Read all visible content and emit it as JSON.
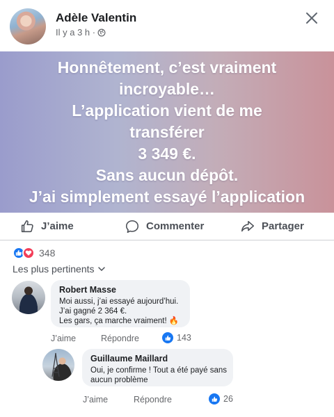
{
  "post": {
    "author": "Adèle Valentin",
    "time": "Il y a 3 h ·",
    "privacy_icon": "globe-icon"
  },
  "banner": {
    "lines": [
      "Honnêtement, c’est vraiment",
      "incroyable…",
      "L’application vient de me",
      "transférer",
      "3 349 €.",
      "Sans aucun dépôt.",
      "J’ai simplement essayé l’application"
    ],
    "gradient": [
      "#9a9ccc",
      "#c9929a"
    ]
  },
  "actions": {
    "like": "J’aime",
    "comment": "Commenter",
    "share": "Partager"
  },
  "reactions": {
    "count": "348"
  },
  "sort": {
    "label": "Les plus pertinents"
  },
  "comments": [
    {
      "name": "Robert Masse",
      "lines": [
        "Moi aussi, j’ai essayé aujourd’hui.",
        " J’ai gagné 2 364 €.",
        " Les gars, ça marche vraiment! 🔥"
      ],
      "like": "J’aime",
      "reply": "Répondre",
      "likes": "143"
    },
    {
      "name": "Guillaume Maillard",
      "lines": [
        "Oui, je confirme ! Tout a été payé sans",
        "aucun problème"
      ],
      "like": "J’aime",
      "reply": "Répondre",
      "likes": "26"
    }
  ],
  "colors": {
    "facebook_blue": "#1877f2",
    "love_red": "#f33e58",
    "bubble_bg": "#f0f2f5",
    "secondary_text": "#65676b"
  }
}
